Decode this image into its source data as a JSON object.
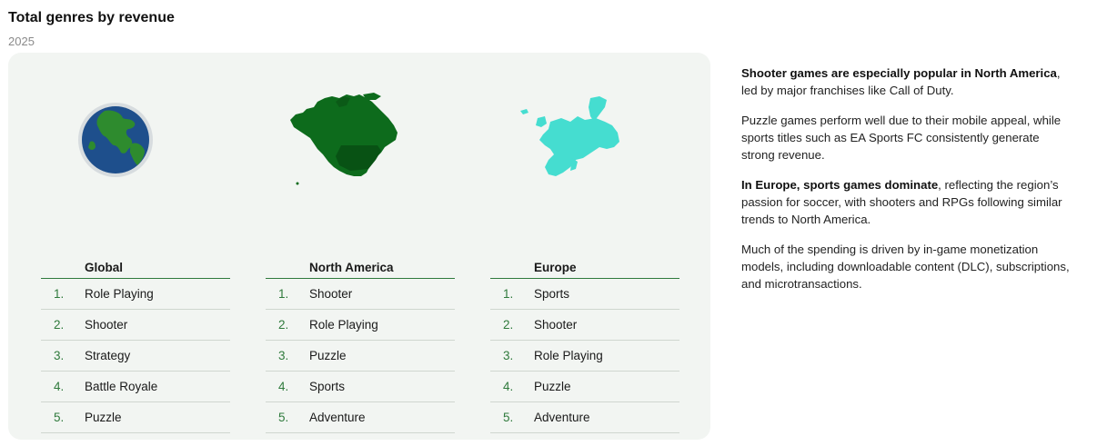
{
  "title": "Total genres by revenue",
  "subtitle": "2025",
  "regions": [
    {
      "name": "Global",
      "icon": "globe-icon",
      "color": "#1d4e89",
      "items": [
        {
          "rank": "1.",
          "genre": "Role Playing"
        },
        {
          "rank": "2.",
          "genre": "Shooter"
        },
        {
          "rank": "3.",
          "genre": "Strategy"
        },
        {
          "rank": "4.",
          "genre": "Battle Royale"
        },
        {
          "rank": "5.",
          "genre": "Puzzle"
        }
      ]
    },
    {
      "name": "North America",
      "icon": "north-america-map-icon",
      "color": "#0d6b1c",
      "items": [
        {
          "rank": "1.",
          "genre": "Shooter"
        },
        {
          "rank": "2.",
          "genre": "Role Playing"
        },
        {
          "rank": "3.",
          "genre": "Puzzle"
        },
        {
          "rank": "4.",
          "genre": "Sports"
        },
        {
          "rank": "5.",
          "genre": "Adventure"
        }
      ]
    },
    {
      "name": "Europe",
      "icon": "europe-map-icon",
      "color": "#45ddd0",
      "items": [
        {
          "rank": "1.",
          "genre": "Sports"
        },
        {
          "rank": "2.",
          "genre": "Shooter"
        },
        {
          "rank": "3.",
          "genre": "Role Playing"
        },
        {
          "rank": "4.",
          "genre": "Puzzle"
        },
        {
          "rank": "5.",
          "genre": "Adventure"
        }
      ]
    }
  ],
  "notes": {
    "p1_bold": "Shooter games are especially popular in North America",
    "p1_rest": ", led by major franchises like Call of Duty.",
    "p2": "Puzzle games perform well due to their mobile appeal, while sports titles such as EA Sports FC consistently generate strong revenue.",
    "p3_bold": "In Europe, sports games dominate",
    "p3_rest": ", reflecting the region’s passion for soccer, with shooters and RPGs following similar trends to North America.",
    "p4": "Much of the spending is driven by in-game monetization models, including downloadable content (DLC), subscriptions, and microtransactions."
  }
}
